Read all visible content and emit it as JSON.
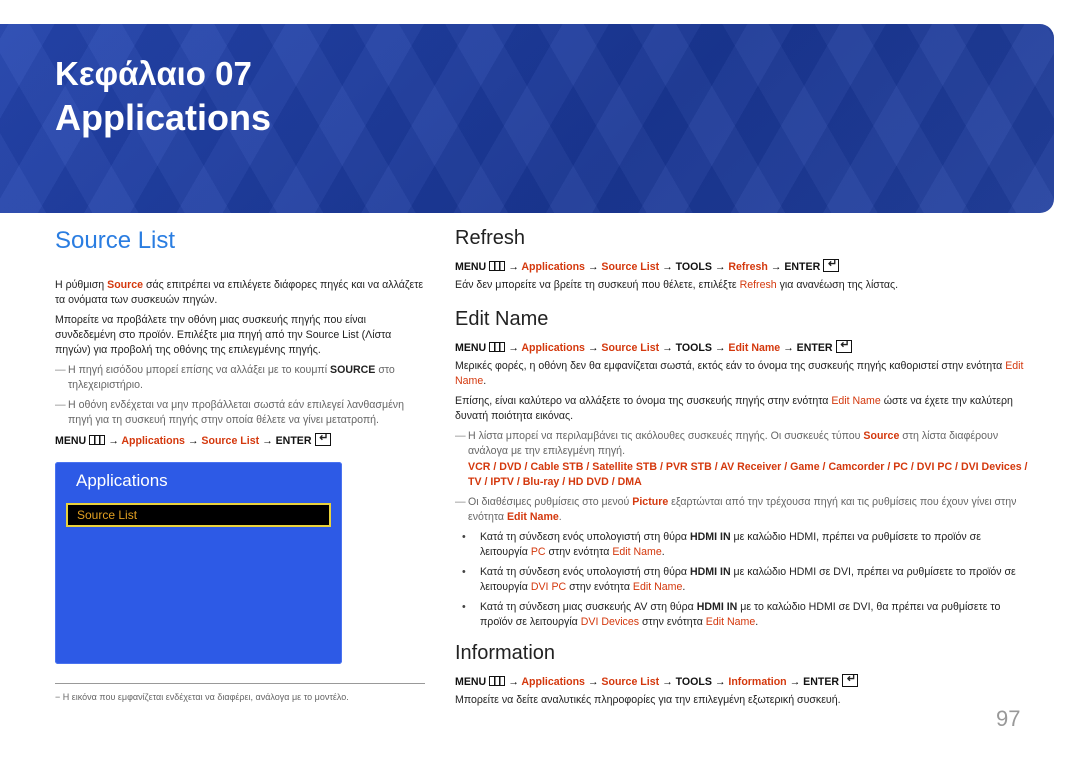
{
  "banner": {
    "chapter": "Κεφάλαιο  07",
    "title": "Applications",
    "color": "#1e3c9e"
  },
  "left": {
    "heading": "Source List",
    "intro": [
      [
        "Η ρύθμιση ",
        ""
      ],
      [
        "Source",
        "o"
      ],
      [
        " σάς επιτρέπει να επιλέγετε διάφορες πηγές και να αλλάζετε τα ονόματα των συσκευών πηγών.",
        ""
      ]
    ],
    "para2": [
      [
        "Μπορείτε να προβάλετε την οθόνη μιας συσκευής πηγής που είναι συνδεδεμένη στο προϊόν. Επιλέξτε μια πηγή από την Source List (Λίστα πηγών) για προβολή της οθόνης της επιλεγμένης πηγής.",
        ""
      ]
    ],
    "note1": [
      [
        "Η πηγή εισόδου μπορεί επίσης να αλλάξει με το κουμπί ",
        ""
      ],
      [
        "SOURCE",
        "b"
      ],
      [
        " στο τηλεχειριστήριο.",
        ""
      ]
    ],
    "note2": [
      [
        "Η οθόνη ενδέχεται να μην προβάλλεται σωστά εάν επιλεγεί λανθασμένη πηγή για τη συσκευή πηγής στην οποία θέλετε να γίνει μετατροπή.",
        ""
      ]
    ],
    "menu": [
      [
        "MENU",
        "m"
      ],
      [
        "",
        "menuicon"
      ],
      [
        "→ ",
        "m"
      ],
      [
        "Applications",
        "o"
      ],
      [
        " → ",
        "m"
      ],
      [
        "Source List",
        "o"
      ],
      [
        " → ENTER",
        "m"
      ],
      [
        "",
        "enter"
      ]
    ],
    "panel": {
      "title": "Applications",
      "selected_item": "Source List"
    },
    "footnote": "−  Η εικόνα που εμφανίζεται ενδέχεται να διαφέρει, ανάλογα με το μοντέλο."
  },
  "refresh": {
    "heading": "Refresh",
    "menu": [
      [
        "MENU",
        "m"
      ],
      [
        "",
        "menuicon"
      ],
      [
        "→ ",
        "m"
      ],
      [
        "Applications",
        "o"
      ],
      [
        " → ",
        "m"
      ],
      [
        "Source List",
        "o"
      ],
      [
        " →  TOOLS → ",
        "m"
      ],
      [
        "Refresh",
        "o"
      ],
      [
        " → ENTER",
        "m"
      ],
      [
        "",
        "enter"
      ]
    ],
    "text": [
      [
        "Εάν δεν μπορείτε να βρείτε τη συσκευή που θέλετε, επιλέξτε ",
        ""
      ],
      [
        "Refresh",
        "r"
      ],
      [
        " για ανανέωση της λίστας.",
        ""
      ]
    ]
  },
  "edit_name": {
    "heading": "Edit Name",
    "menu": [
      [
        "MENU",
        "m"
      ],
      [
        "",
        "menuicon"
      ],
      [
        "→ ",
        "m"
      ],
      [
        "Applications",
        "o"
      ],
      [
        " → ",
        "m"
      ],
      [
        "Source List",
        "o"
      ],
      [
        " →  TOOLS → ",
        "m"
      ],
      [
        "Edit Name",
        "o"
      ],
      [
        " → ENTER",
        "m"
      ],
      [
        "",
        "enter"
      ]
    ],
    "p1": [
      [
        "Μερικές φορές, η οθόνη δεν θα εμφανίζεται σωστά, εκτός εάν το όνομα της συσκευής πηγής καθοριστεί στην ενότητα ",
        ""
      ],
      [
        "Edit Name",
        "r"
      ],
      [
        ".",
        ""
      ]
    ],
    "p2": [
      [
        "Επίσης, είναι καλύτερο να αλλάξετε το όνομα της συσκευής πηγής στην ενότητα ",
        ""
      ],
      [
        "Edit Name",
        "r"
      ],
      [
        " ώστε να έχετε την καλύτερη δυνατή ποιότητα εικόνας.",
        ""
      ]
    ],
    "note1": [
      [
        "Η λίστα μπορεί να περιλαμβάνει τις ακόλουθες συσκευές πηγής. Οι συσκευές τύπου ",
        ""
      ],
      [
        "Source",
        "o"
      ],
      [
        " στη λίστα διαφέρουν ανάλογα με την επιλεγμένη πηγή.",
        ""
      ]
    ],
    "devices": [
      [
        "VCR",
        "o"
      ],
      [
        " / ",
        ""
      ],
      [
        "DVD",
        "o"
      ],
      [
        " / ",
        ""
      ],
      [
        "Cable STB",
        "o"
      ],
      [
        " / ",
        ""
      ],
      [
        "Satellite STB",
        "o"
      ],
      [
        " / ",
        ""
      ],
      [
        "PVR STB",
        "o"
      ],
      [
        " / ",
        ""
      ],
      [
        "AV Receiver",
        "o"
      ],
      [
        " / ",
        ""
      ],
      [
        "Game",
        "o"
      ],
      [
        " / ",
        ""
      ],
      [
        "Camcorder",
        "o"
      ],
      [
        " / ",
        ""
      ],
      [
        "PC",
        "o"
      ],
      [
        " / ",
        ""
      ],
      [
        "DVI PC",
        "o"
      ],
      [
        " / ",
        ""
      ],
      [
        "DVI Devices",
        "o"
      ],
      [
        " / ",
        ""
      ],
      [
        "TV",
        "o"
      ],
      [
        " / ",
        ""
      ],
      [
        "IPTV",
        "o"
      ],
      [
        " / ",
        ""
      ],
      [
        "Blu-ray",
        "o"
      ],
      [
        " / ",
        ""
      ],
      [
        "HD DVD",
        "o"
      ],
      [
        " / ",
        ""
      ],
      [
        "DMA",
        "o"
      ]
    ],
    "note2": [
      [
        "Οι διαθέσιμες ρυθμίσεις στο μενού ",
        ""
      ],
      [
        "Picture",
        "o"
      ],
      [
        " εξαρτώνται από την τρέχουσα πηγή και τις ρυθμίσεις που έχουν γίνει στην ενότητα ",
        ""
      ],
      [
        "Edit Name",
        "o"
      ],
      [
        ".",
        ""
      ]
    ],
    "bullets": [
      [
        [
          "Κατά τη σύνδεση ενός υπολογιστή στη θύρα ",
          ""
        ],
        [
          "HDMI IN",
          "b"
        ],
        [
          " με καλώδιο HDMI, πρέπει να ρυθμίσετε το προϊόν σε λειτουργία ",
          ""
        ],
        [
          "PC",
          "r"
        ],
        [
          " στην ενότητα ",
          ""
        ],
        [
          "Edit Name",
          "r"
        ],
        [
          ".",
          ""
        ]
      ],
      [
        [
          "Κατά τη σύνδεση ενός υπολογιστή στη θύρα ",
          ""
        ],
        [
          "HDMI IN",
          "b"
        ],
        [
          " με καλώδιο HDMI σε DVI, πρέπει να ρυθμίσετε το προϊόν σε λειτουργία ",
          ""
        ],
        [
          "DVI PC",
          "r"
        ],
        [
          " στην ενότητα ",
          ""
        ],
        [
          "Edit Name",
          "r"
        ],
        [
          ".",
          ""
        ]
      ],
      [
        [
          "Κατά τη σύνδεση μιας συσκευής AV στη θύρα ",
          ""
        ],
        [
          "HDMI IN",
          "b"
        ],
        [
          " με το καλώδιο HDMI σε DVI, θα πρέπει να ρυθμίσετε το προϊόν σε λειτουργία ",
          ""
        ],
        [
          "DVI Devices",
          "r"
        ],
        [
          " στην ενότητα ",
          ""
        ],
        [
          "Edit Name",
          "r"
        ],
        [
          ".",
          ""
        ]
      ]
    ]
  },
  "information": {
    "heading": "Information",
    "menu": [
      [
        "MENU",
        "m"
      ],
      [
        "",
        "menuicon"
      ],
      [
        "→ ",
        "m"
      ],
      [
        "Applications",
        "o"
      ],
      [
        " → ",
        "m"
      ],
      [
        "Source List",
        "o"
      ],
      [
        " →  TOOLS → ",
        "m"
      ],
      [
        "Information",
        "o"
      ],
      [
        " → ENTER",
        "m"
      ],
      [
        "",
        "enter"
      ]
    ],
    "text": [
      [
        "Μπορείτε να δείτε αναλυτικές πληροφορίες για την επιλεγμένη εξωτερική συσκευή.",
        ""
      ]
    ]
  },
  "page_number": "97",
  "colors": {
    "accent": "#d4380d",
    "heading_blue": "#2a7de1",
    "panel_blue": "#2d5ae6"
  }
}
